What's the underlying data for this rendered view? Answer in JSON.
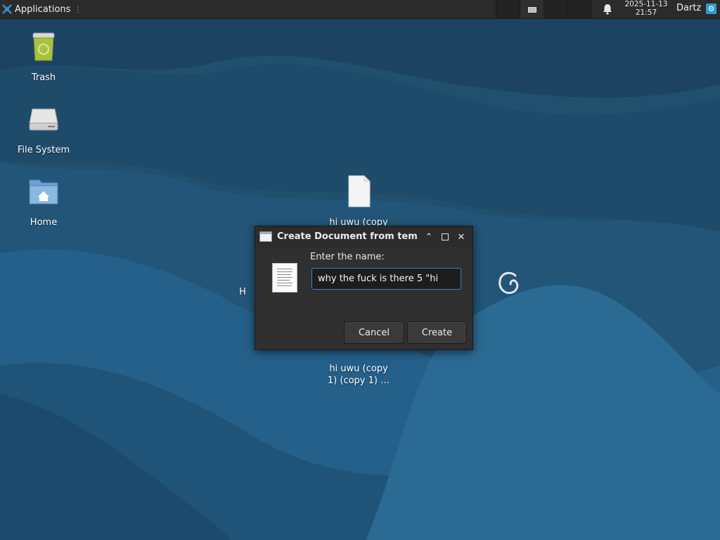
{
  "panel": {
    "applications_label": "Applications",
    "grip": "⋮",
    "clock_date": "2025-11-13",
    "clock_time": "21:57",
    "user_name": "Dartz",
    "user_icon": "gear-icon",
    "notifications_icon": "bell-icon"
  },
  "desktop": {
    "icons": [
      {
        "label": "Trash",
        "icon": "trash-icon"
      },
      {
        "label": "File System",
        "icon": "drive-icon"
      },
      {
        "label": "Home",
        "icon": "home-folder-icon"
      },
      {
        "label": "hi uwu (copy",
        "icon": "file-icon"
      },
      {
        "label": "hi uwu (copy\n1) (copy 1) …",
        "icon": "file-icon"
      },
      {
        "label": "H",
        "icon": "file-icon"
      }
    ]
  },
  "dialog": {
    "title": "Create Document from templ",
    "prompt": "Enter the name:",
    "input_value": "why the fuck is there 5 \"hi",
    "cancel_label": "Cancel",
    "create_label": "Create",
    "minimize_icon": "⌃",
    "maximize_icon": "□",
    "close_icon": "✕"
  },
  "colors": {
    "panel_bg": "#2b2b2b",
    "dialog_bg": "#303030",
    "accent": "#3c7fc2",
    "wallpaper_dark": "#1f4a68",
    "wallpaper_light": "#2a6a93"
  }
}
